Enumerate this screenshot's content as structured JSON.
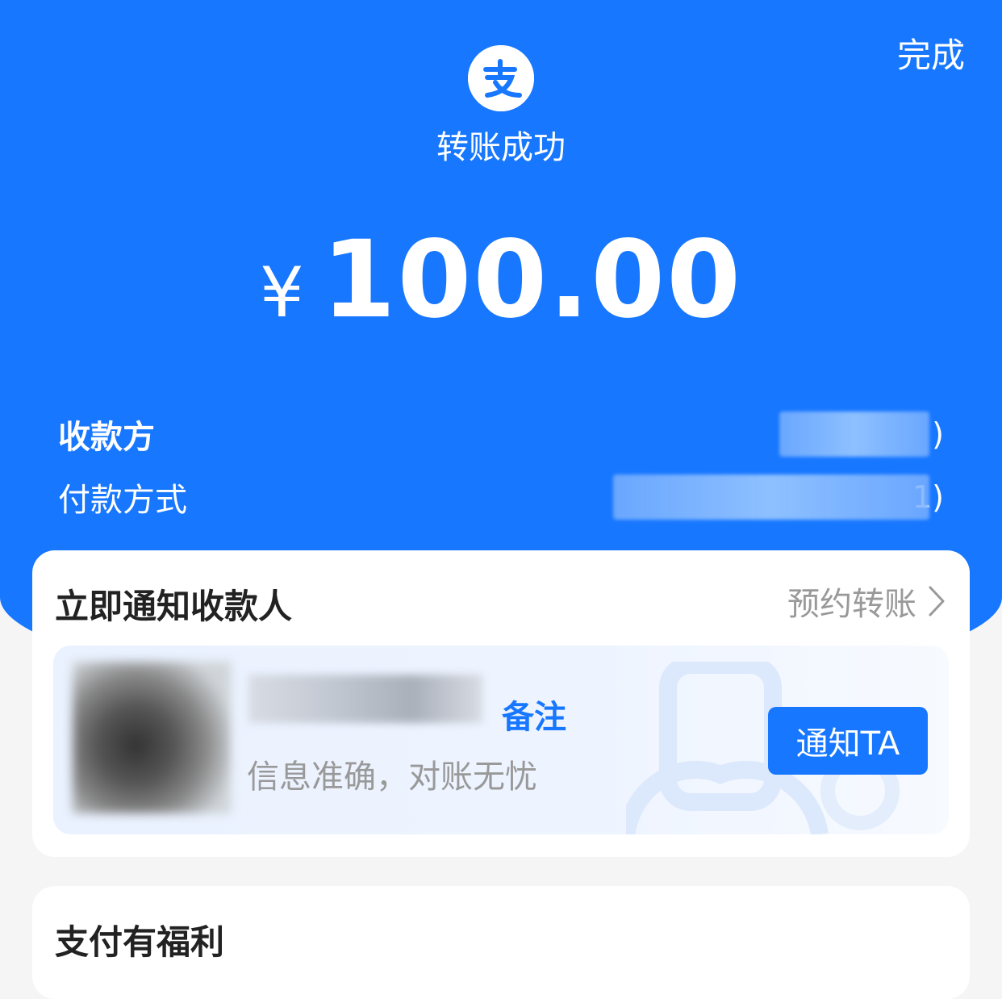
{
  "header": {
    "done_label": "完成",
    "status_title": "转账成功",
    "currency_symbol": "¥",
    "amount": "100.00"
  },
  "details": {
    "payee_label": "收款方",
    "payee_value_suffix": ")",
    "payment_method_label": "付款方式",
    "payment_method_suffix": "1)"
  },
  "notify_card": {
    "title": "立即通知收款人",
    "schedule_link": "预约转账",
    "remark_label": "备注",
    "hint": "信息准确，对账无忧",
    "notify_button": "通知TA"
  },
  "benefits_card": {
    "title": "支付有福利"
  },
  "colors": {
    "primary": "#1777ff",
    "background": "#f5f5f5"
  }
}
